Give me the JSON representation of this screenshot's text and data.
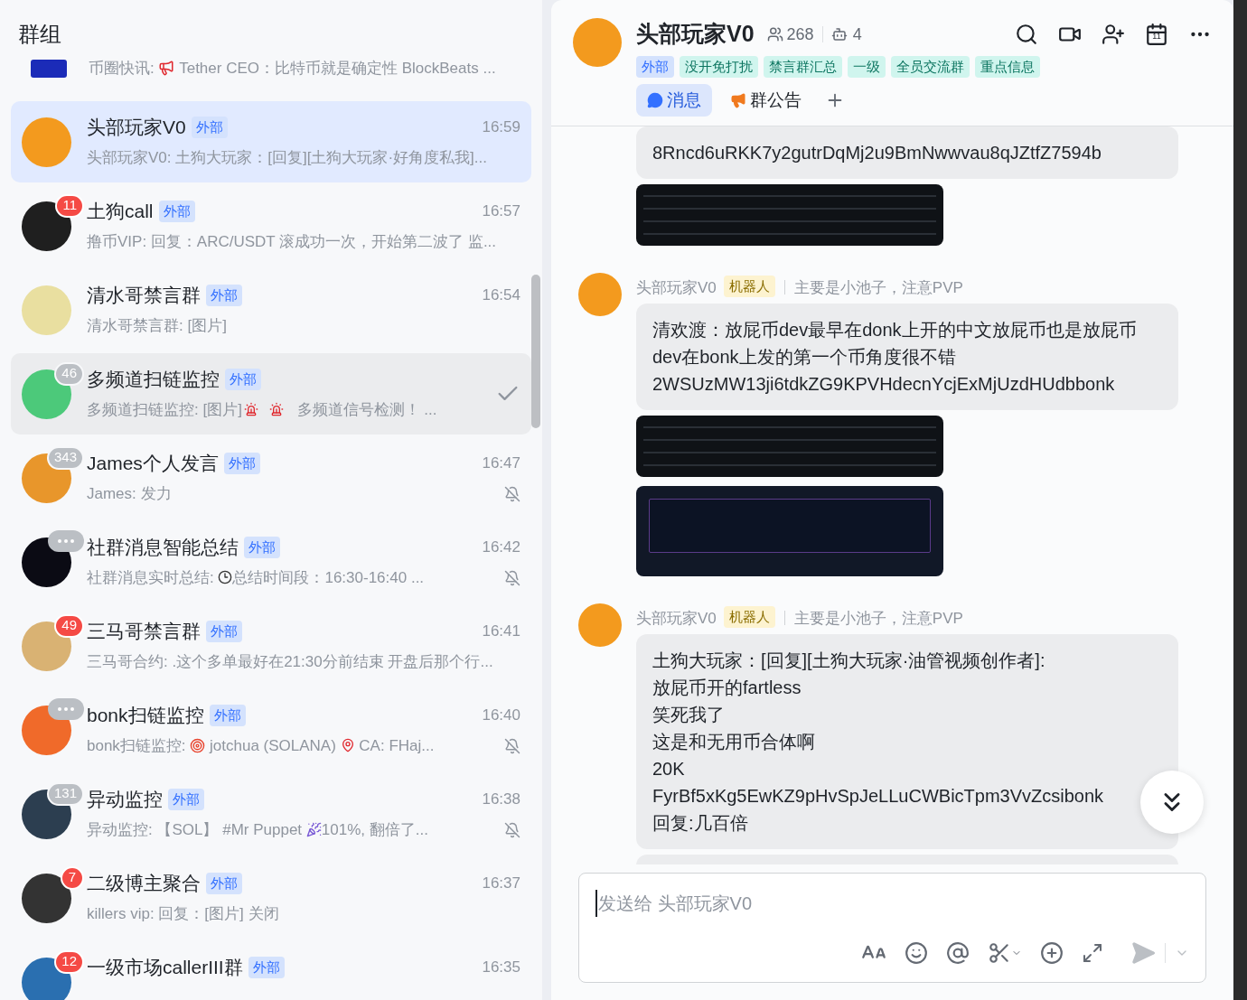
{
  "sidebar": {
    "title": "群组",
    "top_preview": [
      {
        "kind": "text",
        "text": "币圈快讯: "
      },
      {
        "kind": "megaphone"
      },
      {
        "kind": "text",
        "text": " Tether CEO：比特币就是确定性 BlockBeats ..."
      }
    ],
    "chats": [
      {
        "name": "头部玩家V0",
        "tag": "外部",
        "time": "16:59",
        "preview": [
          {
            "kind": "text",
            "text": "头部玩家V0: 土狗大玩家：[回复][土狗大玩家·好角度私我]..."
          }
        ],
        "selected": true,
        "hovered": false,
        "muted": false
      },
      {
        "name": "土狗call",
        "tag": "外部",
        "time": "16:57",
        "preview": [
          {
            "kind": "text",
            "text": "撸币VIP: 回复：ARC/USDT 滚成功一次，开始第二波了 监..."
          }
        ],
        "badge": {
          "kind": "alert",
          "text": "11"
        },
        "selected": false,
        "hovered": false,
        "muted": false
      },
      {
        "name": "清水哥禁言群",
        "tag": "外部",
        "time": "16:54",
        "preview": [
          {
            "kind": "text",
            "text": "清水哥禁言群: [图片]"
          }
        ],
        "selected": false,
        "hovered": false,
        "muted": false
      },
      {
        "name": "多频道扫链监控",
        "tag": "外部",
        "preview": [
          {
            "kind": "text",
            "text": "多频道扫链监控: [图片]"
          },
          {
            "kind": "siren"
          },
          {
            "kind": "siren"
          },
          {
            "kind": "text",
            "text": " 多频道信号检测！ ..."
          }
        ],
        "badge": {
          "kind": "quiet",
          "text": "46"
        },
        "selected": false,
        "hovered": true,
        "muted": false
      },
      {
        "name": "James个人发言",
        "tag": "外部",
        "time": "16:47",
        "preview": [
          {
            "kind": "text",
            "text": "James: 发力"
          }
        ],
        "badge": {
          "kind": "quiet",
          "text": "343"
        },
        "selected": false,
        "hovered": false,
        "muted": true
      },
      {
        "name": "社群消息智能总结",
        "tag": "外部",
        "time": "16:42",
        "preview": [
          {
            "kind": "text",
            "text": "社群消息实时总结: "
          },
          {
            "kind": "clock"
          },
          {
            "kind": "text",
            "text": "总结时间段：16:30-16:40 ..."
          }
        ],
        "badge": {
          "kind": "dots"
        },
        "selected": false,
        "hovered": false,
        "muted": true
      },
      {
        "name": "三马哥禁言群",
        "tag": "外部",
        "time": "16:41",
        "preview": [
          {
            "kind": "text",
            "text": "三马哥合约: .这个多单最好在21:30分前结束 开盘后那个行..."
          }
        ],
        "badge": {
          "kind": "alert",
          "text": "49"
        },
        "selected": false,
        "hovered": false,
        "muted": false
      },
      {
        "name": "bonk扫链监控",
        "tag": "外部",
        "time": "16:40",
        "preview": [
          {
            "kind": "text",
            "text": "bonk扫链监控: "
          },
          {
            "kind": "target"
          },
          {
            "kind": "text",
            "text": " jotchua (SOLANA) "
          },
          {
            "kind": "pin"
          },
          {
            "kind": "text",
            "text": " CA: FHaj..."
          }
        ],
        "badge": {
          "kind": "dots"
        },
        "selected": false,
        "hovered": false,
        "muted": true
      },
      {
        "name": "异动监控",
        "tag": "外部",
        "time": "16:38",
        "preview": [
          {
            "kind": "text",
            "text": "异动监控: 【SOL】 #Mr Puppet "
          },
          {
            "kind": "party"
          },
          {
            "kind": "text",
            "text": "101%, 翻倍了..."
          }
        ],
        "badge": {
          "kind": "quiet",
          "text": "131"
        },
        "selected": false,
        "hovered": false,
        "muted": true
      },
      {
        "name": "二级博主聚合",
        "tag": "外部",
        "time": "16:37",
        "preview": [
          {
            "kind": "text",
            "text": "killers vip: 回复：[图片] 关闭"
          }
        ],
        "badge": {
          "kind": "alert",
          "text": "7"
        },
        "selected": false,
        "hovered": false,
        "muted": false
      },
      {
        "name": "一级市场callerIII群",
        "tag": "外部",
        "time": "16:35",
        "badge": {
          "kind": "alert",
          "text": "12"
        },
        "selected": false,
        "hovered": false
      }
    ]
  },
  "chat": {
    "title": "头部玩家V0",
    "members": "268",
    "bots": "4",
    "calendar_day": "11",
    "tags": [
      {
        "text": "外部",
        "kind": "external"
      },
      {
        "text": "没开免打扰",
        "kind": "label"
      },
      {
        "text": "禁言群汇总",
        "kind": "label"
      },
      {
        "text": "一级",
        "kind": "label"
      },
      {
        "text": "全员交流群",
        "kind": "label"
      },
      {
        "text": "重点信息",
        "kind": "label"
      }
    ],
    "tabs": [
      {
        "label": "消息",
        "kind": "chat",
        "selected": true
      },
      {
        "label": "群公告",
        "kind": "notice",
        "selected": false
      }
    ],
    "messages": [
      {
        "kind": "bubble",
        "lines": [
          "8Rncd6uRKK7y2gutrDqMj2u9BmNwwvau8qJZtfZ7594b"
        ]
      },
      {
        "kind": "table_image"
      },
      {
        "kind": "header",
        "sender": "头部玩家V0",
        "role": "机器人",
        "note": "主要是小池子，注意PVP"
      },
      {
        "kind": "bubble",
        "lines": [
          "清欢渡：放屁币dev最早在donk上开的中文放屁币也是放屁币",
          "dev在bonk上发的第一个币角度很不错",
          "2WSUzMW13ji6tdkZG9KPVHdecnYcjExMjUzdHUdbbonk"
        ]
      },
      {
        "kind": "table_image"
      },
      {
        "kind": "comment_image"
      },
      {
        "kind": "header",
        "sender": "头部玩家V0",
        "role": "机器人",
        "note": "主要是小池子，注意PVP"
      },
      {
        "kind": "bubble",
        "lines": [
          "土狗大玩家：[回复][土狗大玩家·油管视频创作者]:",
          "放屁币开的fartless",
          "笑死我了",
          "这是和无用币合体啊",
          "20K",
          "FyrBf5xKg5EwKZ9pHvSpJeLLuCWBicTpm3VvZcsibonk",
          "回复:几百倍"
        ]
      },
      {
        "kind": "partial_bubble"
      }
    ],
    "composer": {
      "placeholder": "发送给 头部玩家V0"
    }
  }
}
